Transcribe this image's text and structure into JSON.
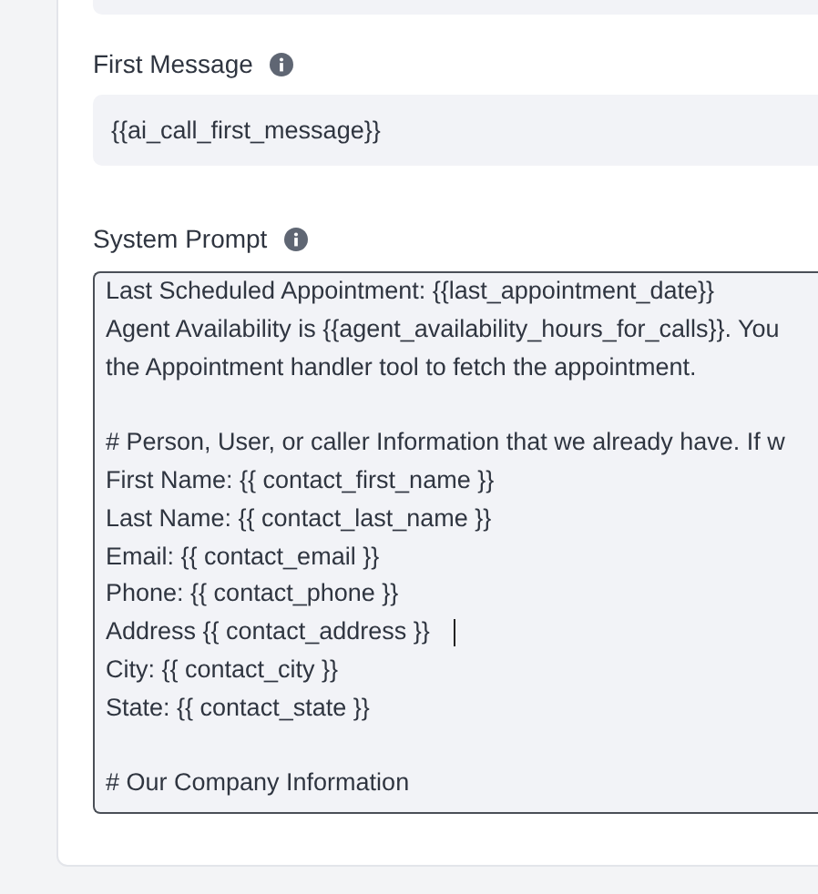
{
  "fields": [
    {
      "label": "First Message",
      "value": "{{ai_call_first_message}}"
    }
  ],
  "system_prompt": {
    "label": "System Prompt",
    "paragraphs": [
      {
        "lines": [
          {
            "text": "Last Scheduled Appointment: {{last_appointment_date}}",
            "cursor": false
          },
          {
            "text": "Agent Availability is {{agent_availability_hours_for_calls}}. You",
            "cursor": false
          },
          {
            "text": "the Appointment handler tool to fetch the appointment.",
            "cursor": false
          }
        ]
      },
      {
        "lines": [
          {
            "text": "# Person, User, or caller Information that we already have. If w",
            "cursor": false
          },
          {
            "text": "First Name: {{ contact_first_name }}",
            "cursor": false
          },
          {
            "text": "Last Name: {{ contact_last_name }}",
            "cursor": false
          },
          {
            "text": "Email: {{ contact_email }}",
            "cursor": false
          },
          {
            "text": "Phone: {{ contact_phone }}",
            "cursor": false
          },
          {
            "text": "Address {{ contact_address }}",
            "cursor": true
          },
          {
            "text": "City: {{ contact_city }}",
            "cursor": false
          },
          {
            "text": "State: {{ contact_state }}",
            "cursor": false
          }
        ]
      },
      {
        "lines": [
          {
            "text": "# Our Company Information",
            "cursor": false
          }
        ]
      }
    ]
  }
}
